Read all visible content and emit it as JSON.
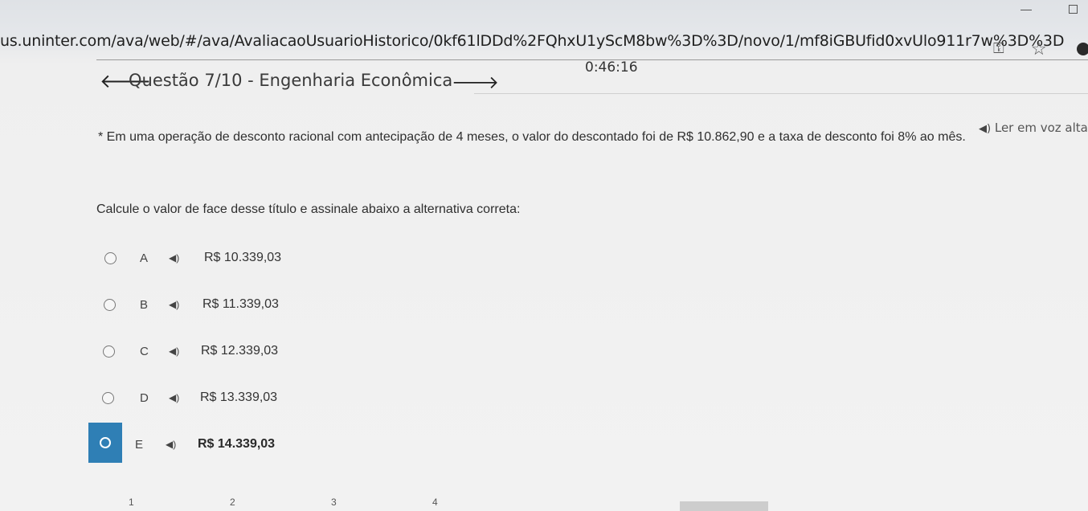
{
  "browser": {
    "url": "us.uninter.com/ava/web/#/ava/AvaliacaoUsuarioHistorico/0kf61lDDd%2FQhxU1yScM8bw%3D%3D/novo/1/mf8iGBUfid0xvUlo911r7w%3D%3D"
  },
  "header": {
    "timer": "0:46:16",
    "title": "Questão 7/10 - Engenharia Econômica"
  },
  "read_aloud": {
    "icon": "speaker-icon",
    "label": "Ler em voz alta"
  },
  "question": {
    "statement": "* Em uma operação de desconto racional com antecipação de 4 meses, o valor do descontado foi de R$ 10.862,90 e a taxa de desconto foi 8% ao mês.",
    "instruction": "Calcule o valor de face desse título e assinale abaixo a alternativa correta:"
  },
  "options": [
    {
      "letter": "A",
      "value": "R$ 10.339,03",
      "selected": false
    },
    {
      "letter": "B",
      "value": "R$ 11.339,03",
      "selected": false
    },
    {
      "letter": "C",
      "value": "R$ 12.339,03",
      "selected": false
    },
    {
      "letter": "D",
      "value": "R$ 13.339,03",
      "selected": false
    },
    {
      "letter": "E",
      "value": "R$ 14.339,03",
      "selected": true
    }
  ],
  "pager": {
    "pages": [
      "1",
      "2",
      "3",
      "4"
    ]
  },
  "colors": {
    "selected": "#2f7fb5"
  }
}
